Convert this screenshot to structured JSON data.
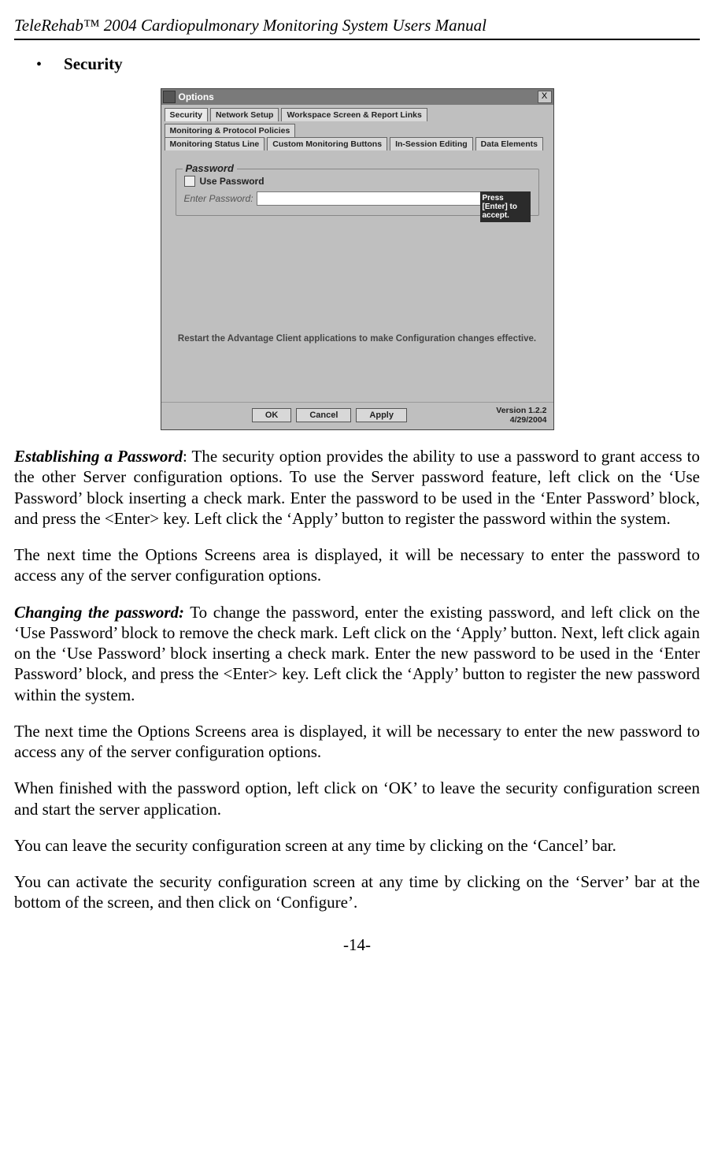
{
  "doc": {
    "header": "TeleRehab™ 2004 Cardiopulmonary Monitoring System Users Manual",
    "bullet": "Security",
    "page": "-14-"
  },
  "shot": {
    "title": "Options",
    "close": "X",
    "tabs1": {
      "t0": "Security",
      "t1": "Network Setup",
      "t2": "Workspace Screen & Report Links",
      "t3": "Monitoring & Protocol Policies"
    },
    "tabs2": {
      "t0": "Monitoring Status Line",
      "t1": "Custom Monitoring Buttons",
      "t2": "In-Session Editing",
      "t3": "Data Elements"
    },
    "group": "Password",
    "use_pw": "Use Password",
    "enter_pw": "Enter Password:",
    "tooltip": "Press [Enter] to accept.",
    "restart": "Restart the Advantage Client applications to make Configuration changes effective.",
    "ok": "OK",
    "cancel": "Cancel",
    "apply": "Apply",
    "version": "Version 1.2.2",
    "date": "4/29/2004"
  },
  "body": {
    "p1_lead": "Establishing a Password",
    "p1_rest": ": The security option provides the ability to use a password to grant access to the other Server configuration options. To use the Server password feature, left click on the ‘Use Password’ block inserting a check mark. Enter the password to be used in the ‘Enter Password’ block, and press the <Enter> key. Left click the ‘Apply’ button to register the password within the system.",
    "p2": "The next time the Options Screens area is displayed, it will be necessary to enter the password to access any of the server configuration options.",
    "p3_lead": "Changing the password:",
    "p3_rest": " To change the password, enter the existing password, and left click on the ‘Use Password’ block to remove the check mark. Left click on the ‘Apply’ button. Next, left click again on the ‘Use Password’ block inserting a check mark. Enter the new password to be used in the ‘Enter Password’ block, and press the <Enter> key. Left click the ‘Apply’ button to register the new password within the system.",
    "p4": "The next time the Options Screens area is displayed, it will be necessary to enter the new password to access any of the server configuration options.",
    "p5": "When finished with the password option, left click on ‘OK’ to leave the security configuration screen and start the server application.",
    "p6": "You can leave the security configuration screen at any time by clicking on the ‘Cancel’ bar.",
    "p7": "You can activate the security configuration screen at any time by clicking on the ‘Server’ bar at the bottom of the screen, and then click on ‘Configure’."
  }
}
